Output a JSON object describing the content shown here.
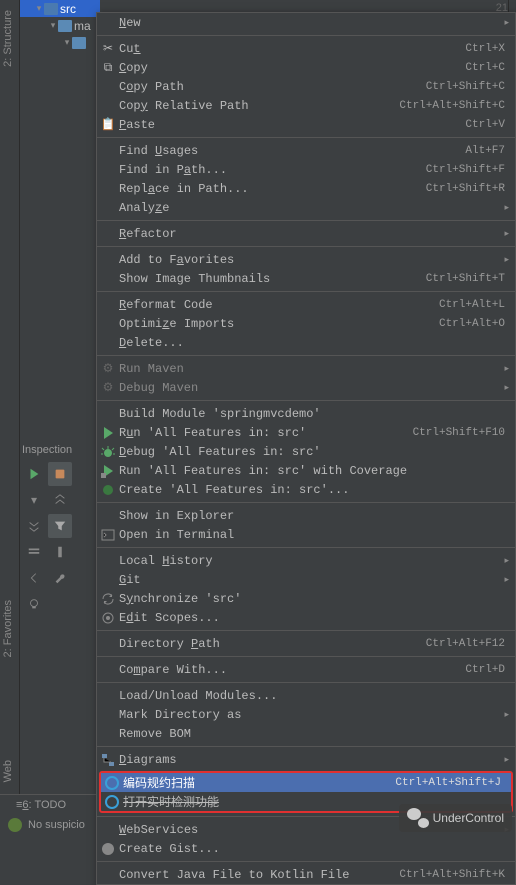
{
  "line_number": "21",
  "left_tabs": {
    "structure": "2: Structure",
    "fav": "2: Favorites",
    "web": "Web"
  },
  "tree": {
    "src": "src",
    "ma": "ma",
    "child": ""
  },
  "menu": {
    "new": "New",
    "cut": "Cut",
    "cut_k": "Ctrl+X",
    "copy": "Copy",
    "copy_k": "Ctrl+C",
    "copy_path": "Copy Path",
    "copy_path_k": "Ctrl+Shift+C",
    "copy_rel": "Copy Relative Path",
    "copy_rel_k": "Ctrl+Alt+Shift+C",
    "paste": "Paste",
    "paste_k": "Ctrl+V",
    "find_usages": "Find Usages",
    "find_usages_k": "Alt+F7",
    "find_in_path": "Find in Path...",
    "find_in_path_k": "Ctrl+Shift+F",
    "replace_in_path": "Replace in Path...",
    "replace_in_path_k": "Ctrl+Shift+R",
    "analyze": "Analyze",
    "refactor": "Refactor",
    "add_fav": "Add to Favorites",
    "show_thumb": "Show Image Thumbnails",
    "show_thumb_k": "Ctrl+Shift+T",
    "reformat": "Reformat Code",
    "reformat_k": "Ctrl+Alt+L",
    "optimize": "Optimize Imports",
    "optimize_k": "Ctrl+Alt+O",
    "delete": "Delete...",
    "run_maven": "Run Maven",
    "debug_maven": "Debug Maven",
    "build_module": "Build Module 'springmvcdemo'",
    "run_all": "Run 'All Features in: src'",
    "run_all_k": "Ctrl+Shift+F10",
    "debug_all": "Debug 'All Features in: src'",
    "coverage": "Run 'All Features in: src' with Coverage",
    "create_all": "Create 'All Features in: src'...",
    "show_explorer": "Show in Explorer",
    "open_terminal": "Open in Terminal",
    "local_history": "Local History",
    "git": "Git",
    "sync": "Synchronize 'src'",
    "edit_scopes": "Edit Scopes...",
    "dir_path": "Directory Path",
    "dir_path_k": "Ctrl+Alt+F12",
    "compare": "Compare With...",
    "compare_k": "Ctrl+D",
    "load_unload": "Load/Unload Modules...",
    "mark_dir": "Mark Directory as",
    "remove_bom": "Remove BOM",
    "diagrams": "Diagrams",
    "scan": "编码规约扫描",
    "scan_k": "Ctrl+Alt+Shift+J",
    "realtime": "打开实时检测功能",
    "webservices": "WebServices",
    "create_gist": "Create Gist...",
    "convert_kotlin": "Convert Java File to Kotlin File",
    "convert_kotlin_k": "Ctrl+Alt+Shift+K"
  },
  "inspection": "Inspection",
  "bottom": {
    "todo": "6: TODO",
    "status": "No suspicio"
  },
  "wechat": "UnderControl"
}
